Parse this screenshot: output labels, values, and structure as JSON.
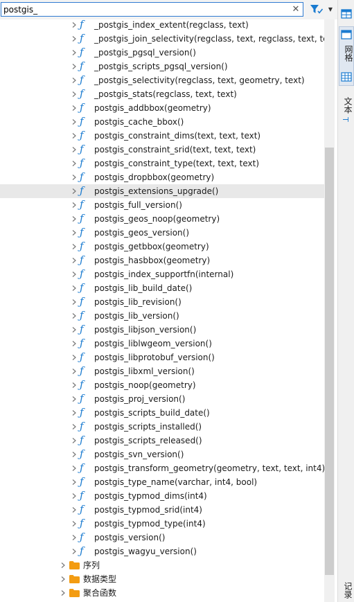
{
  "search": {
    "value": "postgis_",
    "clear_label": "✕"
  },
  "functions": [
    "_postgis_index_extent(regclass, text)",
    "_postgis_join_selectivity(regclass, text, regclass, text, text)",
    "_postgis_pgsql_version()",
    "_postgis_scripts_pgsql_version()",
    "_postgis_selectivity(regclass, text, geometry, text)",
    "_postgis_stats(regclass, text, text)",
    "postgis_addbbox(geometry)",
    "postgis_cache_bbox()",
    "postgis_constraint_dims(text, text, text)",
    "postgis_constraint_srid(text, text, text)",
    "postgis_constraint_type(text, text, text)",
    "postgis_dropbbox(geometry)",
    "postgis_extensions_upgrade()",
    "postgis_full_version()",
    "postgis_geos_noop(geometry)",
    "postgis_geos_version()",
    "postgis_getbbox(geometry)",
    "postgis_hasbbox(geometry)",
    "postgis_index_supportfn(internal)",
    "postgis_lib_build_date()",
    "postgis_lib_revision()",
    "postgis_lib_version()",
    "postgis_libjson_version()",
    "postgis_liblwgeom_version()",
    "postgis_libprotobuf_version()",
    "postgis_libxml_version()",
    "postgis_noop(geometry)",
    "postgis_proj_version()",
    "postgis_scripts_build_date()",
    "postgis_scripts_installed()",
    "postgis_scripts_released()",
    "postgis_svn_version()",
    "postgis_transform_geometry(geometry, text, text, int4)",
    "postgis_type_name(varchar, int4, bool)",
    "postgis_typmod_dims(int4)",
    "postgis_typmod_srid(int4)",
    "postgis_typmod_type(int4)",
    "postgis_version()",
    "postgis_wagyu_version()"
  ],
  "selected_function": "postgis_extensions_upgrade()",
  "folders": [
    "序列",
    "数据类型",
    "聚合函数"
  ],
  "right_panel": {
    "grid_label": "网格",
    "text_label": "文本",
    "log_label": "记录"
  },
  "colors": {
    "accent": "#1a7bd0",
    "folder": "#f39c12",
    "selected_row": "#e8e8e8"
  }
}
